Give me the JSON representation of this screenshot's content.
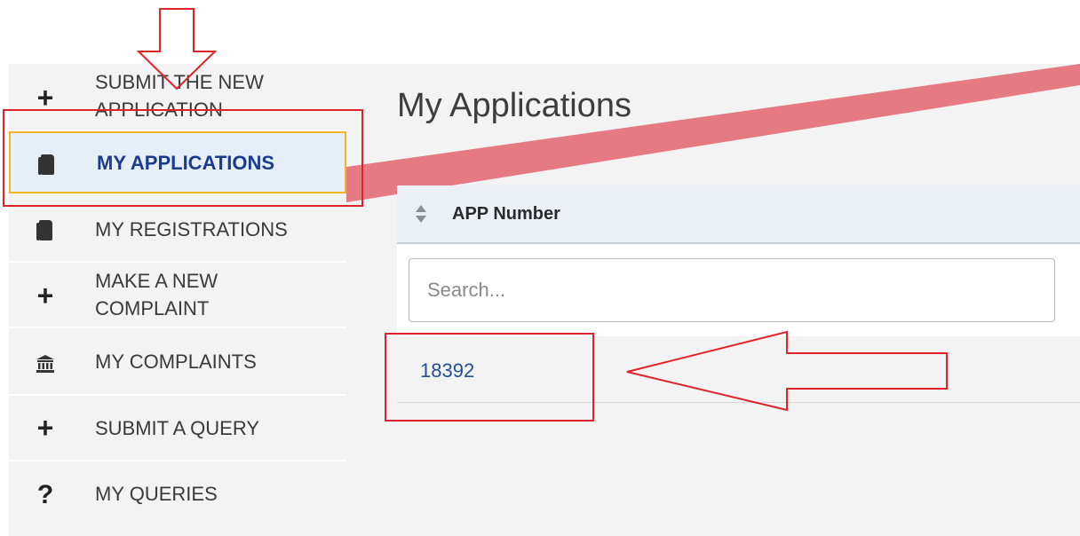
{
  "sidebar": {
    "items": [
      {
        "icon": "plus-icon",
        "line1": "SUBMIT THE NEW",
        "line2": "APPLICATION"
      },
      {
        "icon": "book-icon",
        "label": "MY APPLICATIONS"
      },
      {
        "icon": "book-icon",
        "label": "MY REGISTRATIONS"
      },
      {
        "icon": "plus-icon",
        "line1": "MAKE A NEW",
        "line2": "COMPLAINT"
      },
      {
        "icon": "bank-icon",
        "label": "MY COMPLAINTS"
      },
      {
        "icon": "plus-icon",
        "label": "SUBMIT A QUERY"
      },
      {
        "icon": "question-icon",
        "label": "MY QUERIES"
      }
    ]
  },
  "main": {
    "title": "My Applications",
    "table": {
      "column": "APP Number",
      "search_placeholder": "Search...",
      "rows": [
        {
          "app_number": "18392"
        }
      ]
    }
  },
  "colors": {
    "active_border": "#f0b429",
    "active_bg": "#e6eef8",
    "link": "#1f4e96",
    "annotation_red": "#e0222a",
    "diagonal_band": "#e57a83"
  }
}
